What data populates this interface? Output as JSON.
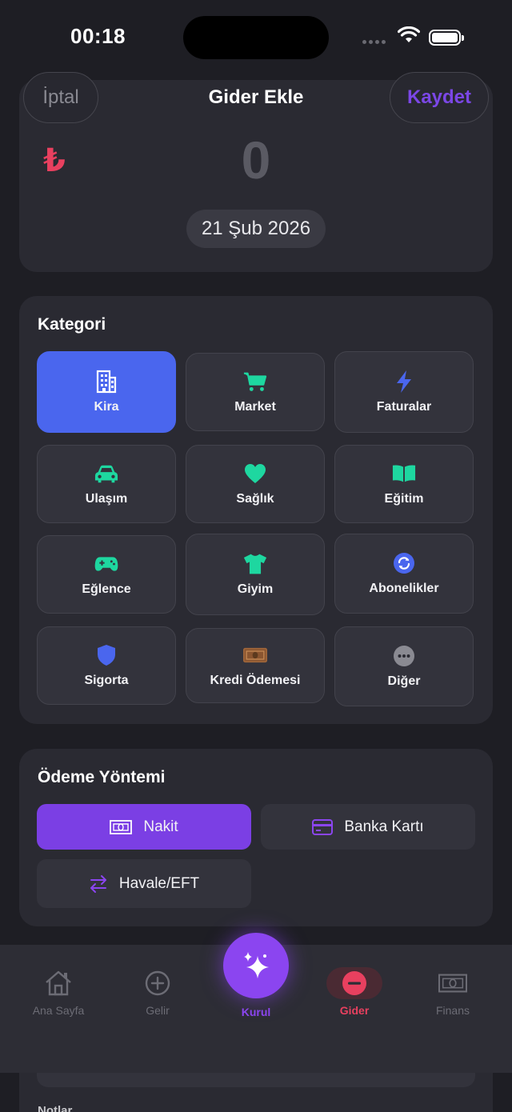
{
  "status_bar": {
    "time": "00:18"
  },
  "header": {
    "title": "Gider Ekle",
    "cancel_label": "İptal",
    "save_label": "Kaydet"
  },
  "amount": {
    "currency_symbol": "₺",
    "value": "0",
    "date": "21 Şub 2026"
  },
  "category": {
    "title": "Kategori",
    "selected": "Kira",
    "items": [
      {
        "label": "Kira",
        "icon": "building-icon",
        "color": "#ffffff"
      },
      {
        "label": "Market",
        "icon": "cart-icon",
        "color": "#1ed7a0"
      },
      {
        "label": "Faturalar",
        "icon": "bolt-icon",
        "color": "#4a66ee"
      },
      {
        "label": "Ulaşım",
        "icon": "car-icon",
        "color": "#1ed7a0"
      },
      {
        "label": "Sağlık",
        "icon": "heart-icon",
        "color": "#1ed7a0"
      },
      {
        "label": "Eğitim",
        "icon": "book-icon",
        "color": "#1ed7a0"
      },
      {
        "label": "Eğlence",
        "icon": "gamepad-icon",
        "color": "#1ed7a0"
      },
      {
        "label": "Giyim",
        "icon": "tshirt-icon",
        "color": "#1ed7a0"
      },
      {
        "label": "Abonelikler",
        "icon": "refresh-icon",
        "color": "#4a66ee"
      },
      {
        "label": "Sigorta",
        "icon": "shield-icon",
        "color": "#4a66ee"
      },
      {
        "label": "Kredi Ödemesi",
        "icon": "banknote-icon",
        "color": "#a0663a"
      },
      {
        "label": "Diğer",
        "icon": "more-icon",
        "color": "#8a8a92"
      }
    ]
  },
  "payment": {
    "title": "Ödeme Yöntemi",
    "selected": "Nakit",
    "methods": [
      {
        "label": "Nakit",
        "icon": "cash-icon"
      },
      {
        "label": "Banka Kartı",
        "icon": "card-icon"
      },
      {
        "label": "Havale/EFT",
        "icon": "transfer-icon"
      }
    ]
  },
  "tabbar": {
    "items": [
      {
        "label": "Ana Sayfa",
        "icon": "home-icon"
      },
      {
        "label": "Gelir",
        "icon": "plus-circle-icon"
      },
      {
        "label": "Kurul",
        "icon": "sparkles-icon"
      },
      {
        "label": "Gider",
        "icon": "minus-circle-icon"
      },
      {
        "label": "Finans",
        "icon": "banknote-icon"
      }
    ],
    "active": "Gider"
  },
  "notes": {
    "label": "Notlar"
  },
  "colors": {
    "accent": "#7b3fe4",
    "selected_category": "#4a66ee",
    "expense": "#e8405f",
    "teal": "#1ed7a0"
  }
}
